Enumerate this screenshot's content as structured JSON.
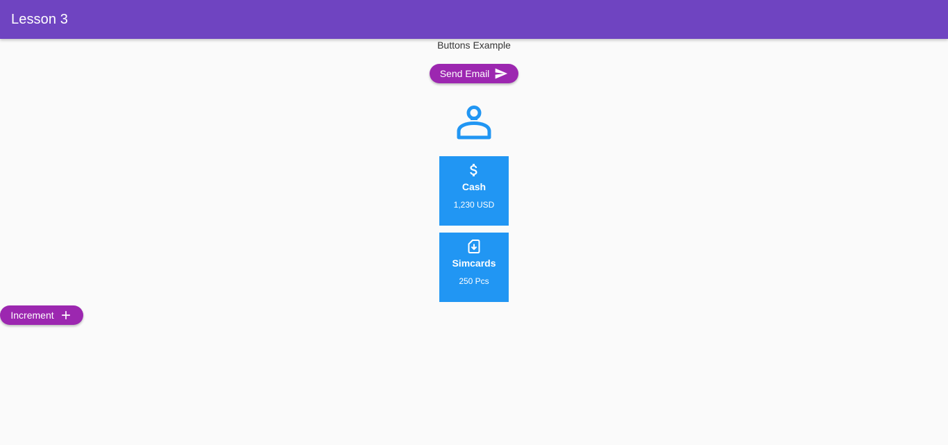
{
  "appbar": {
    "title": "Lesson 3",
    "color": "#6f44c1"
  },
  "main": {
    "subtitle": "Buttons Example",
    "send_button": {
      "label": "Send Email",
      "icon": "send-icon",
      "color": "#9c27b0"
    },
    "person_icon": {
      "icon": "person-icon",
      "color": "#2196f3"
    },
    "tiles": [
      {
        "icon": "dollar-icon",
        "title": "Cash",
        "value": "1,230 USD",
        "color": "#2196f3"
      },
      {
        "icon": "sim-card-download-icon",
        "title": "Simcards",
        "value": "250 Pcs",
        "color": "#2196f3"
      }
    ],
    "increment_button": {
      "label": "Increment",
      "icon": "add-icon",
      "color": "#9c27b0"
    }
  }
}
